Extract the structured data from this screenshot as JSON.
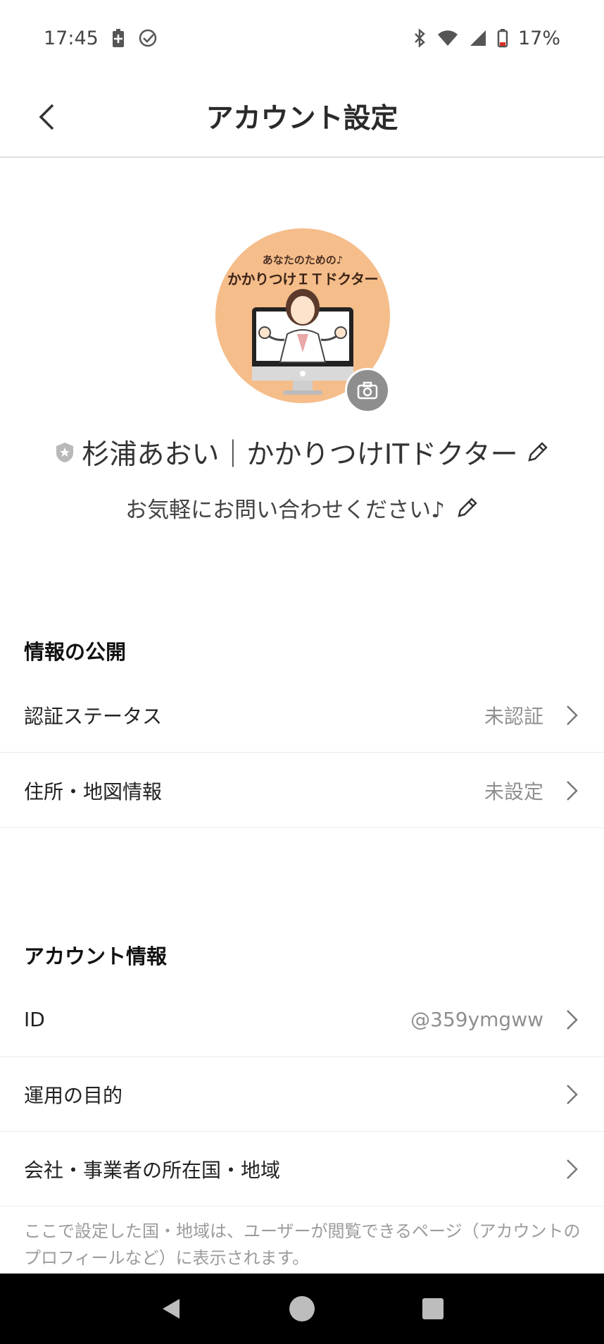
{
  "status_bar": {
    "time": "17:45",
    "battery_percent": "17%",
    "icons": [
      "battery-charging-icon",
      "check-circle-icon",
      "bluetooth-icon",
      "wifi-icon",
      "signal-icon",
      "battery-icon"
    ]
  },
  "header": {
    "title": "アカウント設定",
    "back_icon": "back-chevron-icon"
  },
  "profile": {
    "avatar_caption_top": "あなたのための♪",
    "avatar_caption_main": "かかりつけＩＴドクター",
    "name": "杉浦あおい｜かかりつけITドクター",
    "status_message": "お気軽にお問い合わせください♪",
    "badge_icon": "shield-star-icon",
    "camera_icon": "camera-icon",
    "edit_icon": "pencil-icon"
  },
  "sections": {
    "public_info": {
      "title": "情報の公開",
      "items": [
        {
          "label": "認証ステータス",
          "value": "未認証"
        },
        {
          "label": "住所・地図情報",
          "value": "未設定"
        }
      ]
    },
    "account_info": {
      "title": "アカウント情報",
      "items": [
        {
          "label": "ID",
          "value": "@359ymgww"
        },
        {
          "label": "運用の目的",
          "value": ""
        },
        {
          "label": "会社・事業者の所在国・地域",
          "value": ""
        }
      ]
    }
  },
  "note": "ここで設定した国・地域は、ユーザーが閲覧できるページ（アカウントのプロフィールなど）に表示されます。",
  "nav_bar": {
    "icons": [
      "nav-back-icon",
      "nav-home-icon",
      "nav-recents-icon"
    ]
  },
  "colors": {
    "avatar_bg": "#f5bd8a",
    "secondary_text": "#8f8f8f",
    "divider": "#ececec"
  }
}
